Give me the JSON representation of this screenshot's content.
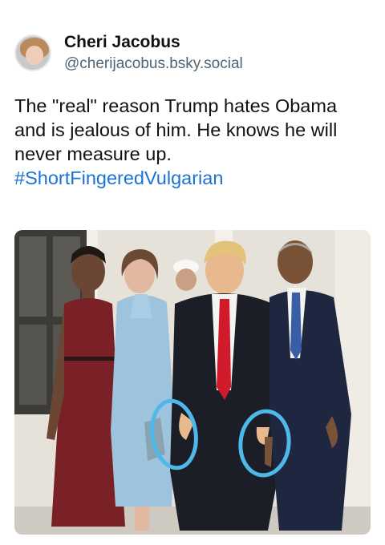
{
  "post": {
    "author": {
      "display_name": "Cheri Jacobus",
      "handle": "@cherijacobus.bsky.social",
      "avatar_icon": "profile-photo-avatar"
    },
    "text": "The \"real\" reason Trump hates Obama and is jealous of him.  He knows he will never measure up.",
    "hashtag": "#ShortFingeredVulgarian",
    "image": {
      "description_icon": "photo-four-people-white-house",
      "annotation_color": "#4fb8ea"
    }
  },
  "colors": {
    "text": "#111111",
    "secondary": "#536471",
    "link": "#1d72d6",
    "background": "#ffffff"
  }
}
